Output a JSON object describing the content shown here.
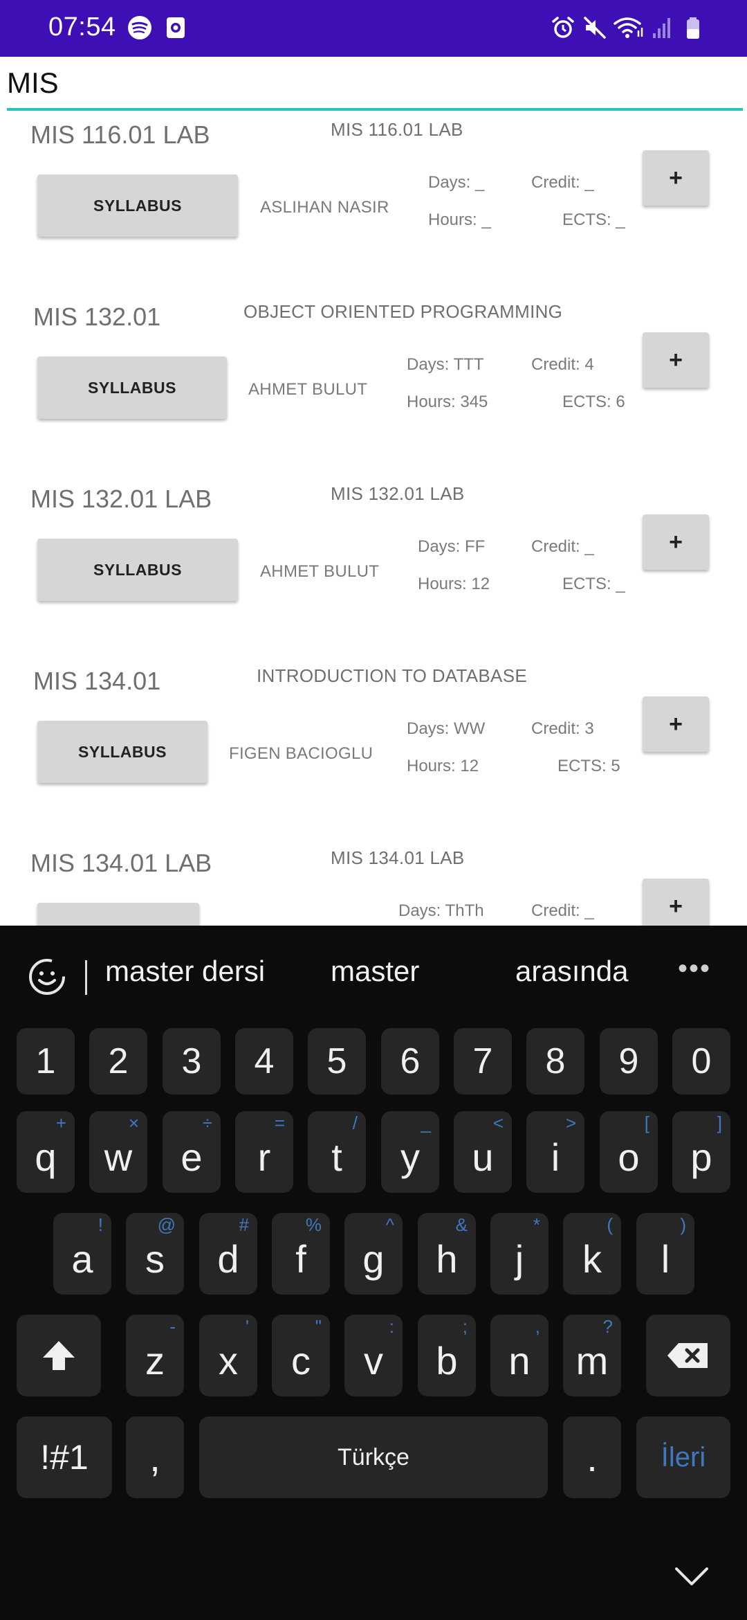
{
  "status_bar": {
    "time": "07:54",
    "icons": [
      "spotify-icon",
      "screen-record-icon",
      "alarm-icon",
      "mute-icon",
      "wifi-icon",
      "signal-icon",
      "battery-icon"
    ],
    "bg_color": "#3d0fb5"
  },
  "search": {
    "query": "MIS",
    "underline_color": "#26c6b8"
  },
  "courses": [
    {
      "code": "MIS 116.01 LAB",
      "title": "MIS 116.01 LAB",
      "button": "SYLLABUS",
      "instructor": "ASLIHAN NASIR",
      "days": "Days: _",
      "hours": "Hours: _",
      "credit": "Credit: _",
      "ects": "ECTS: _",
      "add": "+"
    },
    {
      "code": "MIS 132.01",
      "title": "OBJECT ORIENTED PROGRAMMING",
      "button": "SYLLABUS",
      "instructor": "AHMET BULUT",
      "days": "Days: TTT",
      "hours": "Hours: 345",
      "credit": "Credit: 4",
      "ects": "ECTS: 6",
      "add": "+"
    },
    {
      "code": "MIS 132.01 LAB",
      "title": "MIS 132.01 LAB",
      "button": "SYLLABUS",
      "instructor": "AHMET BULUT",
      "days": "Days: FF",
      "hours": "Hours: 12",
      "credit": "Credit: _",
      "ects": "ECTS: _",
      "add": "+"
    },
    {
      "code": "MIS 134.01",
      "title": "INTRODUCTION TO DATABASE",
      "button": "SYLLABUS",
      "instructor": "FIGEN BACIOGLU",
      "days": "Days: WW",
      "hours": "Hours: 12",
      "credit": "Credit: 3",
      "ects": "ECTS: 5",
      "add": "+"
    },
    {
      "code": "MIS 134.01 LAB",
      "title": "MIS 134.01 LAB",
      "days": "Days: ThTh",
      "credit": "Credit: _",
      "add": "+"
    }
  ],
  "keyboard": {
    "suggestions": [
      "master dersi",
      "master",
      "arasında"
    ],
    "more": "•••",
    "numbers": [
      "1",
      "2",
      "3",
      "4",
      "5",
      "6",
      "7",
      "8",
      "9",
      "0"
    ],
    "row1": [
      {
        "k": "q",
        "h": "+"
      },
      {
        "k": "w",
        "h": "×"
      },
      {
        "k": "e",
        "h": "÷"
      },
      {
        "k": "r",
        "h": "="
      },
      {
        "k": "t",
        "h": "/"
      },
      {
        "k": "y",
        "h": "_"
      },
      {
        "k": "u",
        "h": "<"
      },
      {
        "k": "i",
        "h": ">"
      },
      {
        "k": "o",
        "h": "["
      },
      {
        "k": "p",
        "h": "]"
      }
    ],
    "row2": [
      {
        "k": "a",
        "h": "!"
      },
      {
        "k": "s",
        "h": "@"
      },
      {
        "k": "d",
        "h": "#"
      },
      {
        "k": "f",
        "h": "%"
      },
      {
        "k": "g",
        "h": "^"
      },
      {
        "k": "h",
        "h": "&"
      },
      {
        "k": "j",
        "h": "*"
      },
      {
        "k": "k",
        "h": "("
      },
      {
        "k": "l",
        "h": ")"
      }
    ],
    "row3": [
      {
        "k": "z",
        "h": "-"
      },
      {
        "k": "x",
        "h": "'"
      },
      {
        "k": "c",
        "h": "\""
      },
      {
        "k": "v",
        "h": ":"
      },
      {
        "k": "b",
        "h": ";"
      },
      {
        "k": "n",
        "h": ","
      },
      {
        "k": "m",
        "h": "?"
      }
    ],
    "symbols": "!#1",
    "comma": ",",
    "space": "Türkçe",
    "period": ".",
    "action": "İleri",
    "action_color": "#3f78c0"
  }
}
